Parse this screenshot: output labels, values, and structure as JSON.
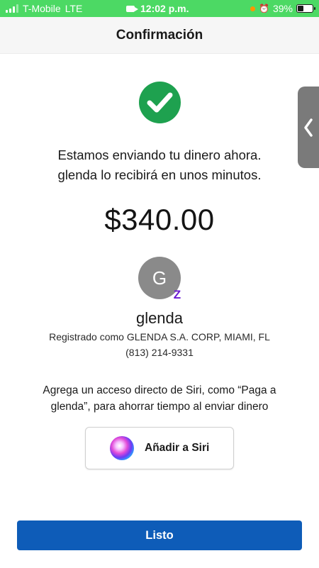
{
  "status_bar": {
    "carrier": "T-Mobile",
    "network": "LTE",
    "time": "12:02 p.m.",
    "battery": "39%"
  },
  "header": {
    "title": "Confirmación"
  },
  "confirmation": {
    "message_line1": "Estamos enviando tu dinero ahora.",
    "message_line2": "glenda lo recibirá en unos minutos.",
    "amount": "$340.00"
  },
  "recipient": {
    "avatar_initial": "G",
    "name": "glenda",
    "registered": "Registrado como GLENDA S.A. CORP, MIAMI, FL",
    "phone": "(813) 214-9331",
    "badge_icon": "zelle-icon"
  },
  "siri": {
    "prompt_line1": "Agrega un acceso directo de Siri, como “Paga a",
    "prompt_line2": "glenda”, para ahorrar tiempo al enviar dinero",
    "button_label": "Añadir a Siri"
  },
  "actions": {
    "done_label": "Listo"
  },
  "colors": {
    "status_bar": "#4cd964",
    "success_green": "#1ea14f",
    "primary_blue": "#0e5cb8",
    "zelle_purple": "#6c1cd3"
  }
}
